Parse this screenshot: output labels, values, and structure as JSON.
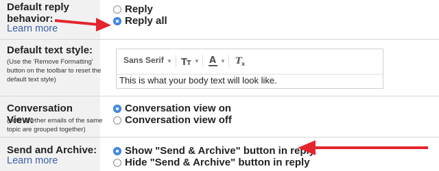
{
  "sections": {
    "reply": {
      "title_line1": "Default reply",
      "title_line2": "behavior:",
      "learn_more": "Learn more",
      "options": [
        {
          "label": "Reply",
          "selected": false
        },
        {
          "label": "Reply all",
          "selected": true
        }
      ]
    },
    "text_style": {
      "title": "Default text style:",
      "help": [
        "(Use the 'Remove Formatting'",
        "button on the toolbar to reset the",
        "default text style)"
      ],
      "font": "Sans Serif",
      "size_icon": "text-size-icon",
      "color_icon": "text-color-icon",
      "clear_icon": "remove-formatting-icon",
      "preview": "This is what your body text will look like."
    },
    "conversation": {
      "title": "Conversation View:",
      "help": [
        "(sets whether emails of the same",
        "topic are grouped together)"
      ],
      "options": [
        {
          "label": "Conversation view on",
          "selected": true
        },
        {
          "label": "Conversation view off",
          "selected": false
        }
      ]
    },
    "send_archive": {
      "title": "Send and Archive:",
      "learn_more": "Learn more",
      "options": [
        {
          "label": "Show \"Send & Archive\" button in reply",
          "selected": true
        },
        {
          "label": "Hide \"Send & Archive\" button in reply",
          "selected": false
        }
      ]
    }
  },
  "colors": {
    "link": "#3b5fa8",
    "radio_selected": "#4a8fe7",
    "arrow": "#e3262e",
    "label_bg": "#f1f1f1"
  }
}
